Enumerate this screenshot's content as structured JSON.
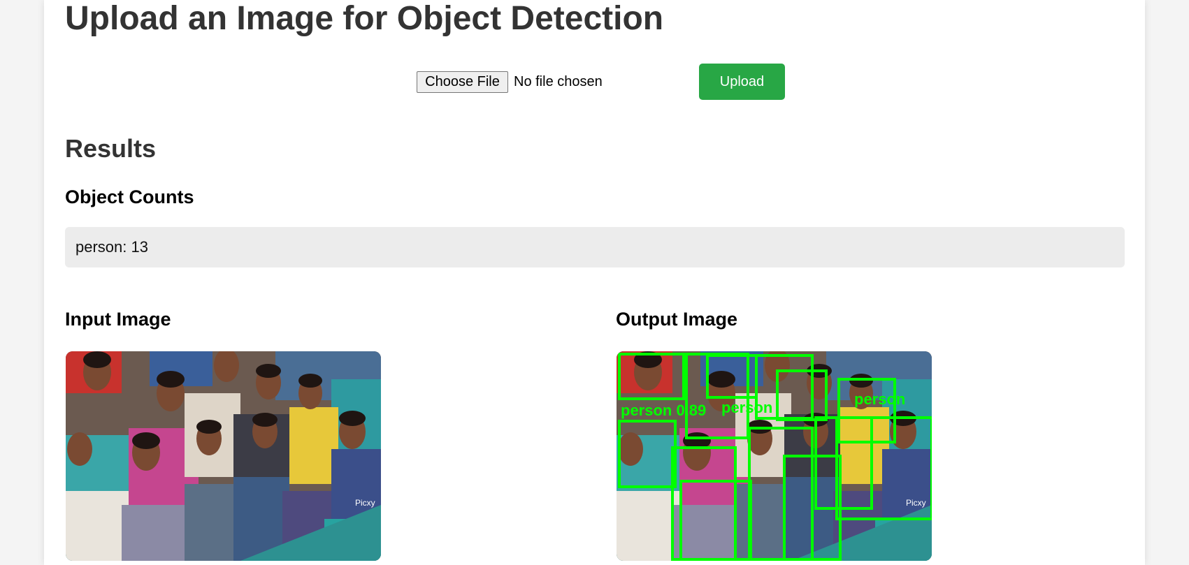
{
  "page": {
    "title": "Upload an Image for Object Detection"
  },
  "upload": {
    "choose_label": "Choose File",
    "file_status": "No file chosen",
    "upload_label": "Upload"
  },
  "results": {
    "title": "Results",
    "counts_title": "Object Counts",
    "counts": [
      {
        "text": "person: 13"
      }
    ]
  },
  "images": {
    "input_title": "Input Image",
    "output_title": "Output Image",
    "watermark": "Picxy",
    "detection_color": "#00ff00",
    "detection_labels": [
      "person 0.89",
      "person",
      "person"
    ]
  },
  "colors": {
    "accent": "#28a745",
    "box_bg": "#ececec",
    "title": "#333333"
  }
}
